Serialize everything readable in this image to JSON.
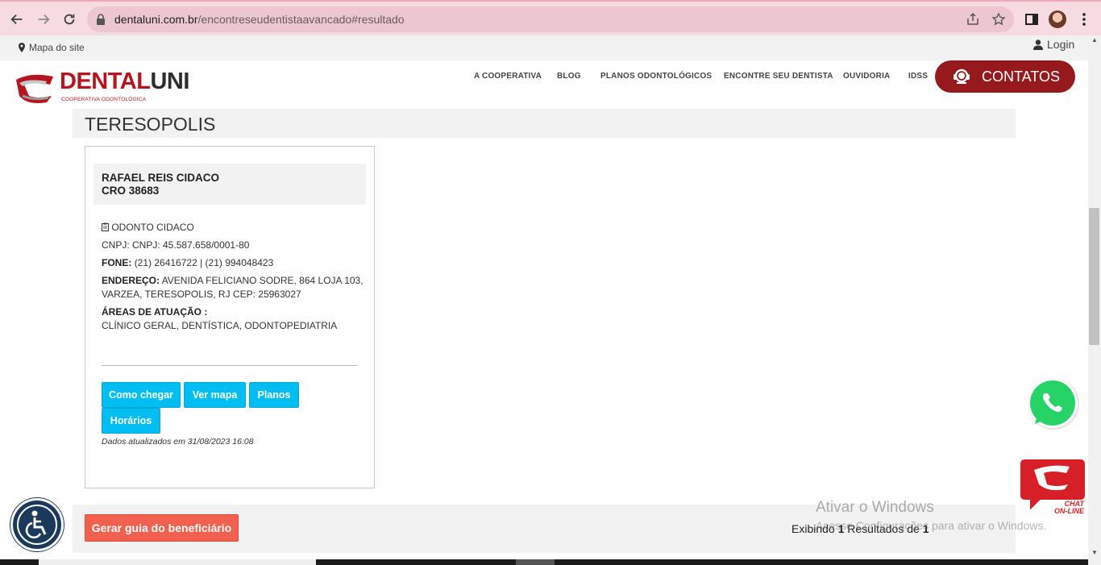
{
  "browser": {
    "url_domain": "dentaluni.com.br",
    "url_path": "/encontreseudentistaavancado#resultado"
  },
  "topbar": {
    "sitemap": "Mapa do site",
    "login": "Login"
  },
  "header": {
    "logo_part1": "DENTAL",
    "logo_part2": "UNI",
    "logo_sub": "COOPERATIVA ODONTOLÓGICA",
    "menu": [
      "A COOPERATIVA",
      "BLOG",
      "PLANOS ODONTOLÓGICOS",
      "ENCONTRE SEU DENTISTA",
      "OUVIDORIA",
      "IDSS"
    ],
    "contatos": "CONTATOS"
  },
  "result": {
    "city": "TERESOPOLIS",
    "dentist_name": "RAFAEL REIS CIDACO",
    "cro": "CRO 38683",
    "clinic": "ODONTO CIDACO",
    "cnpj": "CNPJ: CNPJ: 45.587.658/0001-80",
    "fone_label": "FONE:",
    "fone": "(21) 26416722 | (21) 994048423",
    "endereco_label": "ENDEREÇO:",
    "endereco_line1": "AVENIDA FELICIANO SODRE, 864 LOJA 103,",
    "endereco_line2": "VARZEA, TERESOPOLIS, RJ CEP: 25963027",
    "areas_label": "ÁREAS DE ATUAÇÃO :",
    "areas": "CLÍNICO GERAL, DENTÍSTICA, ODONTOPEDIATRIA",
    "buttons": {
      "como_chegar": "Como chegar",
      "ver_mapa": "Ver mapa",
      "planos": "Planos",
      "horarios": "Horários"
    },
    "updated": "Dados atualizados em 31/08/2023 16:08"
  },
  "footer": {
    "guia_button": "Gerar guia do beneficiário",
    "results_prefix": "Exibindo",
    "results_count": "1",
    "results_middle": "Resultados de",
    "results_total": "1"
  },
  "chat": {
    "label1": "CHAT",
    "label2": "ON-LINE"
  },
  "windows": {
    "line1": "Ativar o Windows",
    "line2": "Acesse Configurações para ativar o Windows."
  },
  "colors": {
    "brand_red": "#96191e",
    "button_blue": "#00bdf2",
    "guia_orange": "#f2604f"
  }
}
